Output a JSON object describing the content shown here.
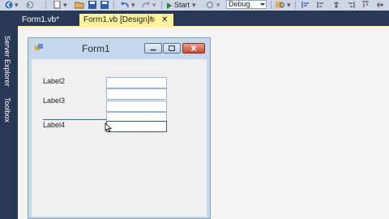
{
  "toolbar": {
    "start_label": "Start",
    "config_value": "Debug"
  },
  "tabs": [
    {
      "label": "Form1.vb*"
    },
    {
      "label": "Form1.vb [Design]*"
    }
  ],
  "side_panel": {
    "server_explorer": "Server Explorer",
    "toolbox": "Toolbox"
  },
  "form": {
    "title": "Form1",
    "labels": [
      "Label2",
      "Label3",
      "Label4"
    ],
    "textbox_values": [
      "",
      "",
      "",
      "",
      ""
    ]
  },
  "colors": {
    "active_tab": "#fff29d",
    "panel_bg": "#293955",
    "snapline": "#2b6bb6"
  },
  "icons": [
    "back-icon",
    "forward-icon",
    "new-item-icon",
    "open-icon",
    "save-icon",
    "undo-icon",
    "redo-icon",
    "start-icon",
    "pin-icon",
    "close-icon",
    "form-icon",
    "minimize-icon",
    "maximize-icon",
    "cursor-icon"
  ]
}
